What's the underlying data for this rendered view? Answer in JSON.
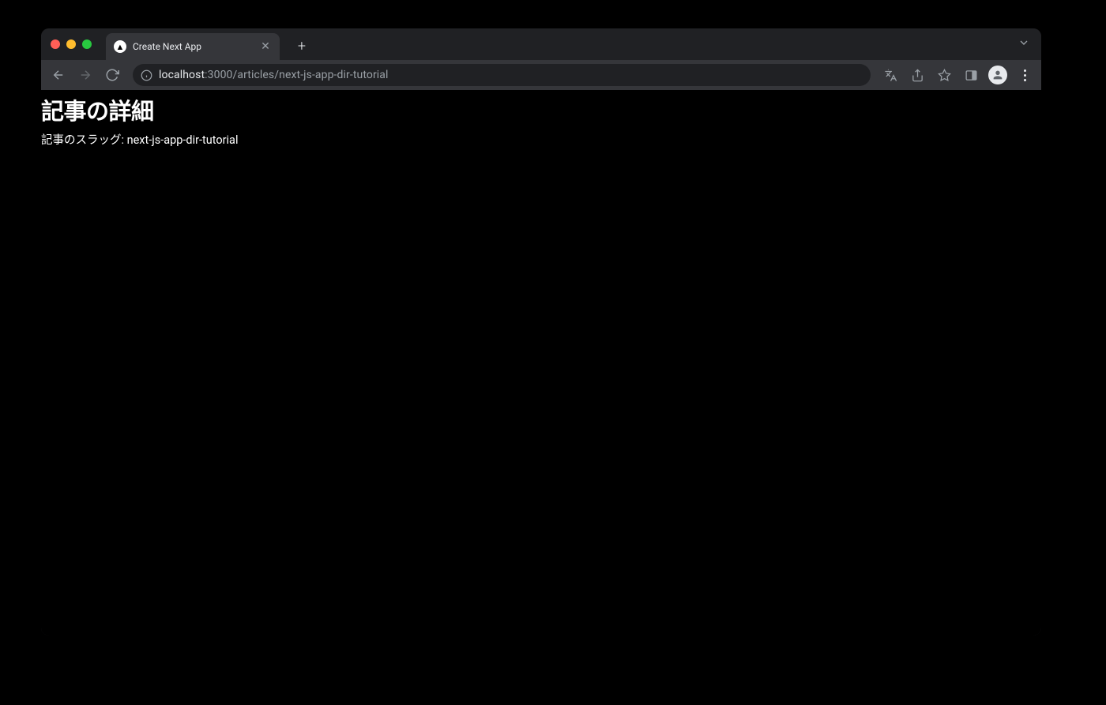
{
  "browser": {
    "tab": {
      "favicon_glyph": "▲",
      "title": "Create Next App"
    },
    "address": {
      "host": "localhost",
      "rest": ":3000/articles/next-js-app-dir-tutorial"
    }
  },
  "page": {
    "heading": "記事の詳細",
    "slug_label": "記事のスラッグ: ",
    "slug_value": "next-js-app-dir-tutorial"
  }
}
